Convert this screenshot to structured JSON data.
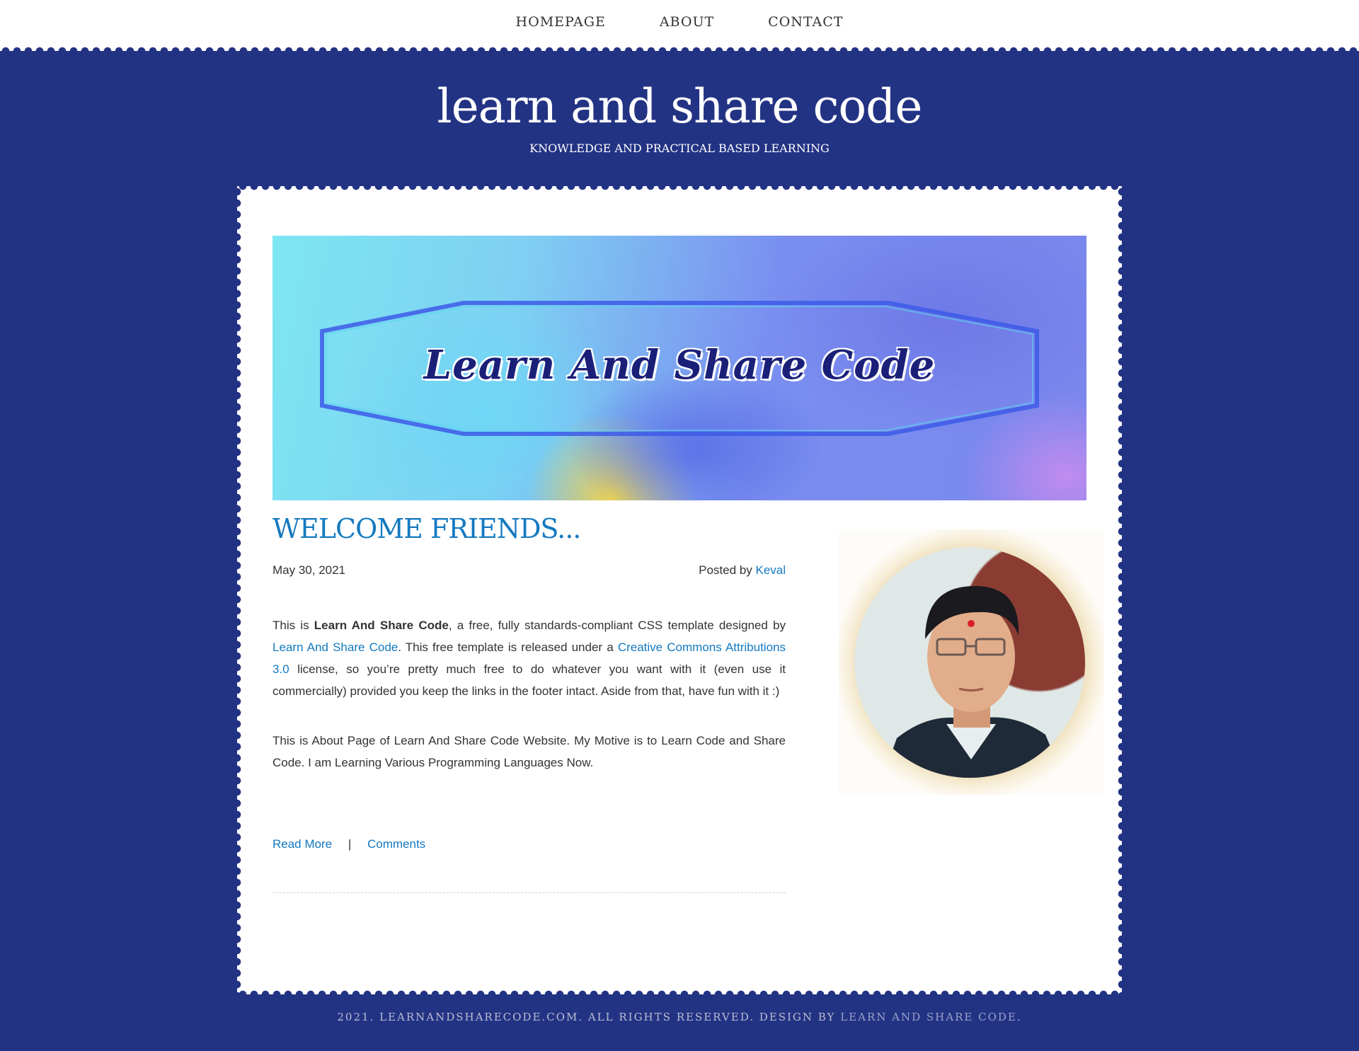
{
  "nav": {
    "items": [
      {
        "label": "HOMEPAGE"
      },
      {
        "label": "ABOUT"
      },
      {
        "label": "CONTACT"
      }
    ]
  },
  "header": {
    "title": "learn and share code",
    "tagline": "KNOWLEDGE AND PRACTICAL BASED LEARNING"
  },
  "banner": {
    "text": "Learn And Share Code"
  },
  "post": {
    "title": "WELCOME FRIENDS...",
    "date": "May 30, 2021",
    "posted_by_label": "Posted by",
    "author": "Keval",
    "p1": {
      "intro": "This is ",
      "bold": "Learn And Share Code",
      "mid1": ", a free, fully standards-compliant CSS template designed by ",
      "link1": "Learn And Share Code",
      "mid2": ". This free template is released under a ",
      "link2": "Creative Commons Attributions 3.0",
      "end": " license, so you’re pretty much free to do whatever you want with it (even use it commercially) provided you keep the links in the footer intact. Aside from that, have fun with it :)"
    },
    "p2": "This is About Page of Learn And Share Code Website. My Motive is to Learn Code and Share Code. I am Learning Various Programming Languages Now.",
    "read_more": "Read More",
    "separator": "|",
    "comments": "Comments"
  },
  "footer": {
    "text": "2021. LEARNANDSHARECODE.COM. ALL RIGHTS RESERVED. DESIGN BY ",
    "link": "LEARN AND SHARE CODE",
    "end": "."
  },
  "colors": {
    "background": "#233384",
    "accent_link": "#1479c0",
    "footer_text": "#b9bdd2"
  }
}
